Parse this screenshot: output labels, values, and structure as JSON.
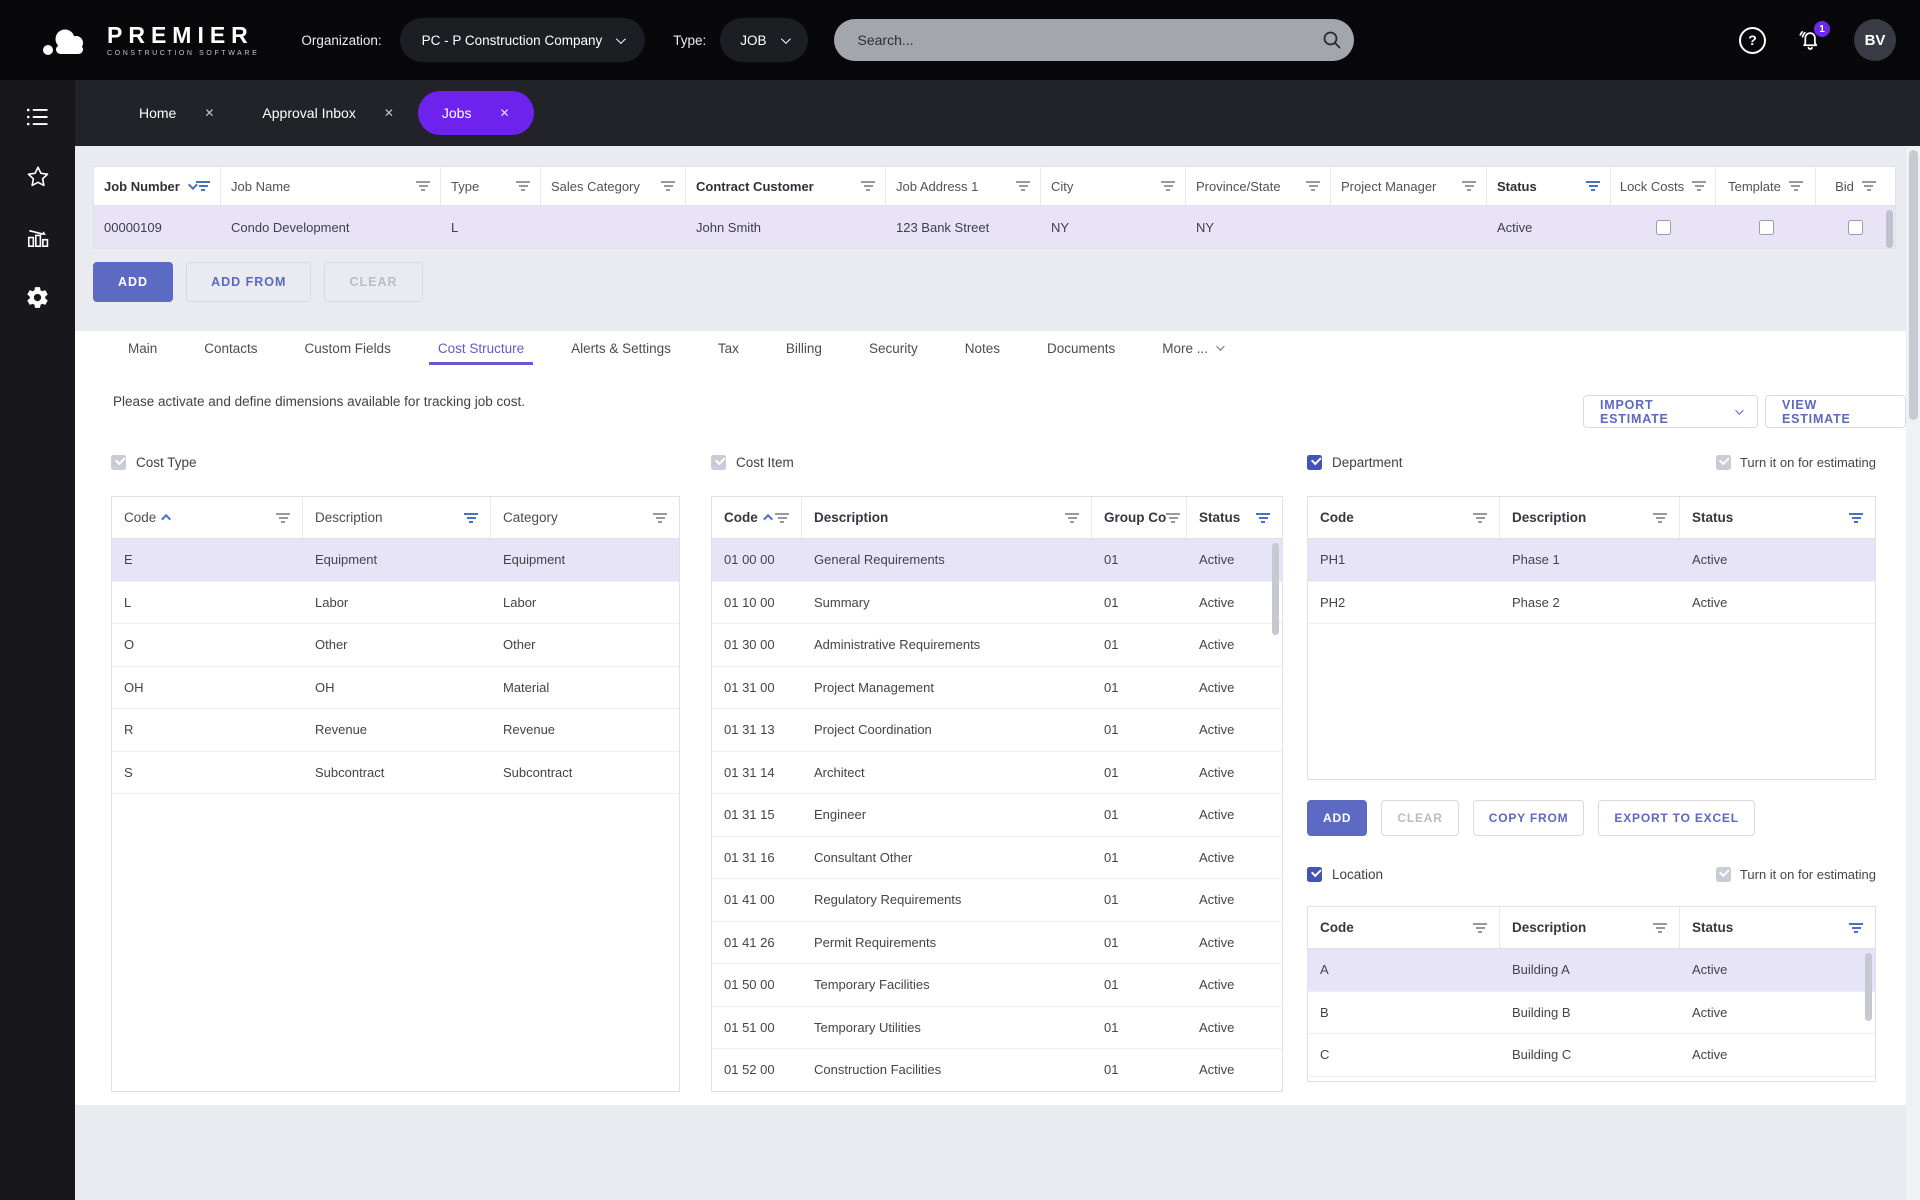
{
  "header": {
    "brand_name": "PREMIER",
    "brand_tagline": "CONSTRUCTION SOFTWARE",
    "organization_label": "Organization:",
    "organization_value": "PC - P Construction Company",
    "type_label": "Type:",
    "type_value": "JOB",
    "search_placeholder": "Search...",
    "notification_count": "1",
    "avatar_initials": "BV"
  },
  "nav_tabs": {
    "items": [
      {
        "label": "Home"
      },
      {
        "label": "Approval Inbox"
      },
      {
        "label": "Jobs"
      }
    ],
    "active_index": 2
  },
  "jobs_grid": {
    "columns": [
      {
        "label": "Job Number",
        "bold": true,
        "sort": "desc",
        "filter": "active"
      },
      {
        "label": "Job Name"
      },
      {
        "label": "Type"
      },
      {
        "label": "Sales Category"
      },
      {
        "label": "Contract Customer",
        "bold": true
      },
      {
        "label": "Job Address 1"
      },
      {
        "label": "City"
      },
      {
        "label": "Province/State"
      },
      {
        "label": "Project Manager"
      },
      {
        "label": "Status",
        "bold": true,
        "filter": "active"
      },
      {
        "label": "Lock Costs"
      },
      {
        "label": "Template"
      },
      {
        "label": "Bid"
      }
    ],
    "row": {
      "job_number": "00000109",
      "job_name": "Condo Development",
      "type": "L",
      "sales_category": "",
      "contract_customer": "John Smith",
      "job_address_1": "123 Bank Street",
      "city": "NY",
      "province_state": "NY",
      "project_manager": "",
      "status": "Active",
      "lock_costs_checked": false,
      "template_checked": false,
      "bid_checked": false
    }
  },
  "grid_actions": {
    "add": "ADD",
    "add_from": "ADD FROM",
    "clear": "CLEAR"
  },
  "subtabs": {
    "items": [
      "Main",
      "Contacts",
      "Custom Fields",
      "Cost Structure",
      "Alerts & Settings",
      "Tax",
      "Billing",
      "Security",
      "Notes",
      "Documents",
      "More ..."
    ],
    "active": "Cost Structure"
  },
  "cost_structure": {
    "note": "Please activate and define dimensions available for tracking job cost.",
    "import_estimate_label": "IMPORT ESTIMATE",
    "view_estimate_label": "VIEW ESTIMATE",
    "estimating_label": "Turn it on for estimating",
    "cost_type": {
      "title": "Cost Type",
      "enabled_checked": true,
      "columns": [
        "Code",
        "Description",
        "Category"
      ],
      "selected": 0,
      "rows": [
        [
          "E",
          "Equipment",
          "Equipment"
        ],
        [
          "L",
          "Labor",
          "Labor"
        ],
        [
          "O",
          "Other",
          "Other"
        ],
        [
          "OH",
          "OH",
          "Material"
        ],
        [
          "R",
          "Revenue",
          "Revenue"
        ],
        [
          "S",
          "Subcontract",
          "Subcontract"
        ]
      ]
    },
    "cost_item": {
      "title": "Cost Item",
      "enabled_checked": true,
      "columns": [
        "Code",
        "Description",
        "Group Co",
        "Status"
      ],
      "selected": 0,
      "rows": [
        [
          "01 00 00",
          "General Requirements",
          "01",
          "Active"
        ],
        [
          "01 10 00",
          "Summary",
          "01",
          "Active"
        ],
        [
          "01 30 00",
          "Administrative Requirements",
          "01",
          "Active"
        ],
        [
          "01 31 00",
          "Project Management",
          "01",
          "Active"
        ],
        [
          "01 31 13",
          "Project Coordination",
          "01",
          "Active"
        ],
        [
          "01 31 14",
          "Architect",
          "01",
          "Active"
        ],
        [
          "01 31 15",
          "Engineer",
          "01",
          "Active"
        ],
        [
          "01 31 16",
          "Consultant Other",
          "01",
          "Active"
        ],
        [
          "01 41 00",
          "Regulatory Requirements",
          "01",
          "Active"
        ],
        [
          "01 41 26",
          "Permit Requirements",
          "01",
          "Active"
        ],
        [
          "01 50 00",
          "Temporary Facilities",
          "01",
          "Active"
        ],
        [
          "01 51 00",
          "Temporary Utilities",
          "01",
          "Active"
        ],
        [
          "01 52 00",
          "Construction Facilities",
          "01",
          "Active"
        ]
      ]
    },
    "department": {
      "title": "Department",
      "enabled_checked": true,
      "estimating_checked": true,
      "columns": [
        "Code",
        "Description",
        "Status"
      ],
      "selected": 0,
      "rows": [
        [
          "PH1",
          "Phase 1",
          "Active"
        ],
        [
          "PH2",
          "Phase 2",
          "Active"
        ]
      ],
      "actions": {
        "add": "ADD",
        "clear": "CLEAR",
        "copy_from": "COPY FROM",
        "export": "EXPORT TO EXCEL"
      }
    },
    "location": {
      "title": "Location",
      "enabled_checked": true,
      "estimating_checked": true,
      "columns": [
        "Code",
        "Description",
        "Status"
      ],
      "selected": 0,
      "rows": [
        [
          "A",
          "Building A",
          "Active"
        ],
        [
          "B",
          "Building B",
          "Active"
        ],
        [
          "C",
          "Building C",
          "Active"
        ]
      ]
    }
  }
}
